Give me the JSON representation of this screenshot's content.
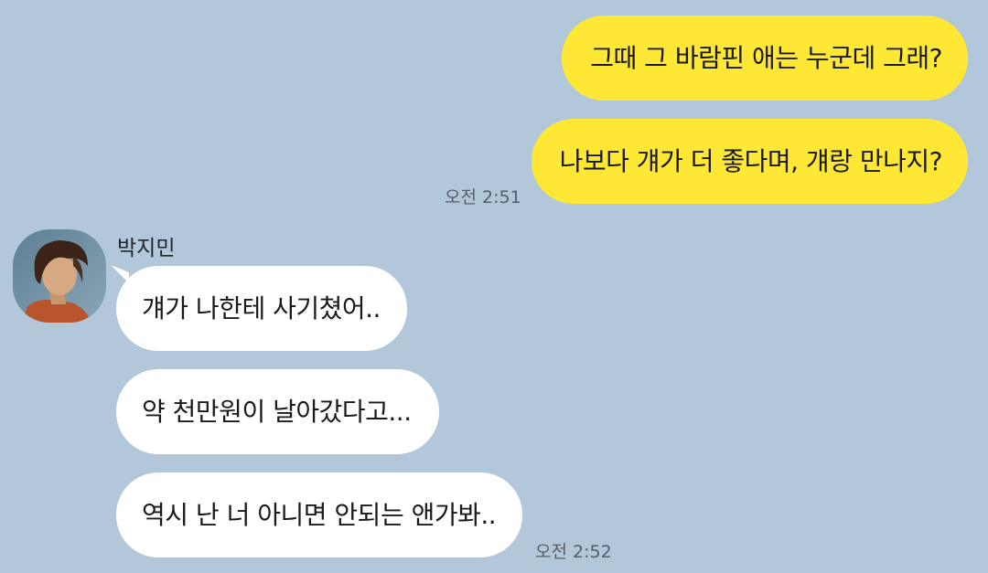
{
  "outgoing": {
    "messages": [
      "그때 그 바람핀 애는 누군데 그래?",
      "나보다 걔가 더 좋다며, 걔랑 만나지?"
    ],
    "time": "오전 2:51"
  },
  "incoming": {
    "sender_name": "박지민",
    "avatar_icon": "profile-photo",
    "messages": [
      "걔가 나한테 사기쳤어..",
      "약 천만원이 날아갔다고...",
      "역시 난 너 아니면 안되는 앤가봐.."
    ],
    "time": "오전 2:52"
  },
  "colors": {
    "background": "#b2c7da",
    "outgoing_bubble": "#fee835",
    "incoming_bubble": "#ffffff",
    "timestamp": "#555e66"
  }
}
